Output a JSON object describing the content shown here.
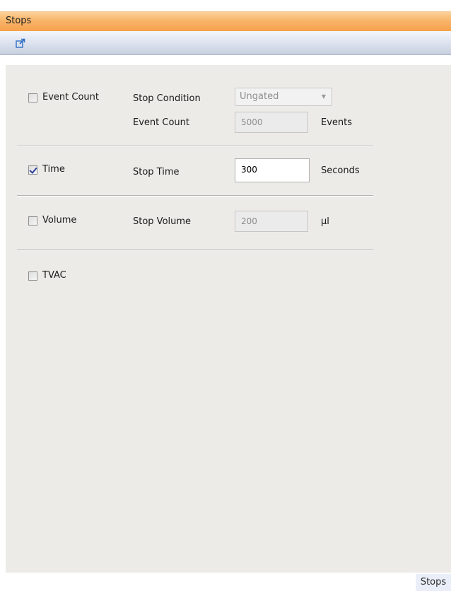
{
  "window": {
    "title": "Stops"
  },
  "toolbar": {
    "popout_icon": "popout-icon"
  },
  "sections": {
    "event_count": {
      "checkbox_label": "Event Count",
      "checked": false,
      "stop_condition_label": "Stop Condition",
      "stop_condition_value": "Ungated",
      "event_count_label": "Event Count",
      "event_count_value": "5000",
      "event_count_unit": "Events"
    },
    "time": {
      "checkbox_label": "Time",
      "checked": true,
      "stop_time_label": "Stop Time",
      "stop_time_value": "300",
      "stop_time_unit": "Seconds"
    },
    "volume": {
      "checkbox_label": "Volume",
      "checked": false,
      "stop_volume_label": "Stop Volume",
      "stop_volume_value": "200",
      "stop_volume_unit": "µl"
    },
    "tvac": {
      "checkbox_label": "TVAC",
      "checked": false
    }
  },
  "footer": {
    "tab_label": "Stops"
  },
  "colors": {
    "title_bar": "#f8b56a",
    "panel_bg": "#ecebe8",
    "check_mark": "#2a3e9c"
  }
}
